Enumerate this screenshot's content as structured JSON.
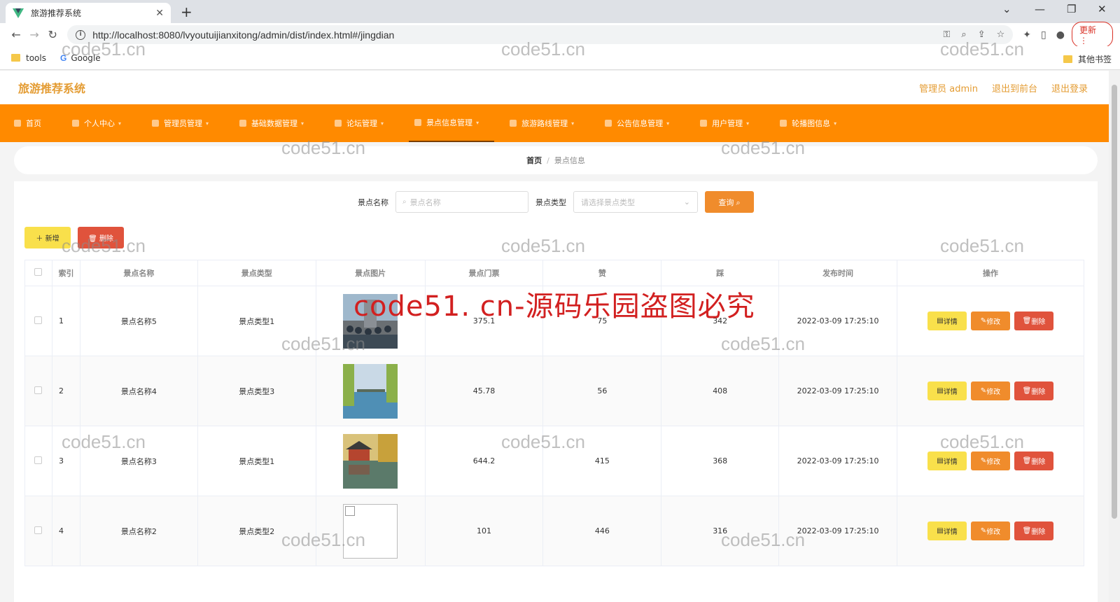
{
  "browser": {
    "tab_title": "旅游推荐系统",
    "url": "http://localhost:8080/lvyoutuijianxitong/admin/dist/index.html#/jingdian",
    "update_label": "更新",
    "bookmarks": [
      "tools",
      "Google"
    ],
    "other_bookmarks": "其他书签"
  },
  "app": {
    "brand": "旅游推荐系统",
    "top_links": [
      "管理员 admin",
      "退出到前台",
      "退出登录"
    ]
  },
  "menu": [
    {
      "label": "首页",
      "icon": "home-icon"
    },
    {
      "label": "个人中心",
      "icon": "user-icon"
    },
    {
      "label": "管理员管理",
      "icon": "admin-icon"
    },
    {
      "label": "基础数据管理",
      "icon": "data-icon"
    },
    {
      "label": "论坛管理",
      "icon": "forum-icon"
    },
    {
      "label": "景点信息管理",
      "icon": "scenic-icon"
    },
    {
      "label": "旅游路线管理",
      "icon": "route-icon"
    },
    {
      "label": "公告信息管理",
      "icon": "notice-icon"
    },
    {
      "label": "用户管理",
      "icon": "users-icon"
    },
    {
      "label": "轮播图信息",
      "icon": "carousel-icon"
    }
  ],
  "breadcrumb": {
    "home": "首页",
    "current": "景点信息"
  },
  "search": {
    "name_label": "景点名称",
    "name_placeholder": "景点名称",
    "type_label": "景点类型",
    "type_placeholder": "请选择景点类型",
    "query_label": "查询"
  },
  "actions": {
    "add": "＋ 新增",
    "delete": "🗑 删除"
  },
  "table": {
    "headers": [
      "索引",
      "景点名称",
      "景点类型",
      "景点图片",
      "景点门票",
      "赞",
      "踩",
      "发布时间",
      "操作"
    ],
    "rows": [
      {
        "index": "1",
        "name": "景点名称5",
        "type": "景点类型1",
        "price": "375.1",
        "likes": "75",
        "dislikes": "342",
        "time": "2022-03-09 17:25:10",
        "image": "crowd"
      },
      {
        "index": "2",
        "name": "景点名称4",
        "type": "景点类型3",
        "price": "45.78",
        "likes": "56",
        "dislikes": "408",
        "time": "2022-03-09 17:25:10",
        "image": "lake"
      },
      {
        "index": "3",
        "name": "景点名称3",
        "type": "景点类型1",
        "price": "644.2",
        "likes": "415",
        "dislikes": "368",
        "time": "2022-03-09 17:25:10",
        "image": "pavilion"
      },
      {
        "index": "4",
        "name": "景点名称2",
        "type": "景点类型2",
        "price": "101",
        "likes": "446",
        "dislikes": "316",
        "time": "2022-03-09 17:25:10",
        "image": "broken"
      }
    ],
    "op_labels": {
      "detail": "详情",
      "edit": "修改",
      "remove": "删除"
    }
  },
  "watermarks": {
    "small": "code51.cn",
    "big": "code51. cn-源码乐园盗图必究"
  }
}
